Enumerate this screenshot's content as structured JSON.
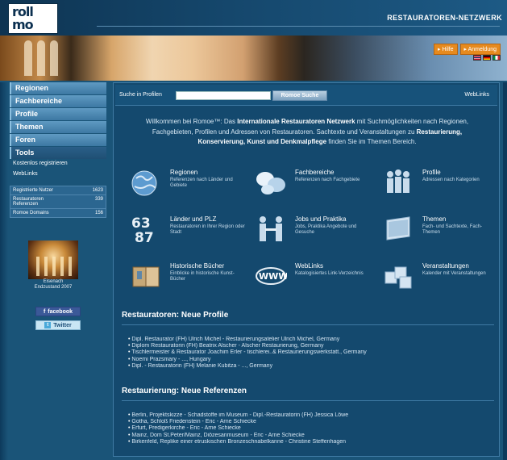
{
  "header": {
    "logo_line1": "roll",
    "logo_line2": "mo",
    "network_title": "RESTAURATOREN-NETZWERK",
    "help_label": "Hilfe",
    "login_label": "Anmeldung",
    "flags": [
      "english-flag",
      "german-flag",
      "italian-flag"
    ]
  },
  "nav": {
    "items": [
      {
        "label": "Regionen"
      },
      {
        "label": "Fachbereiche"
      },
      {
        "label": "Profile"
      },
      {
        "label": "Themen"
      },
      {
        "label": "Foren"
      },
      {
        "label": "Tools"
      }
    ],
    "sublinks": [
      "Kostenlos registrieren",
      "WebLinks"
    ],
    "stats": [
      {
        "label": "Registrierte Nutzer",
        "value": "1623"
      },
      {
        "label": "Restauratoren Referenzen",
        "value": "339"
      },
      {
        "label": "Romoe Domains",
        "value": "156"
      }
    ],
    "image_caption_line1": "Eisenach",
    "image_caption_line2": "Endzustand 2007",
    "facebook_label": "facebook",
    "twitter_label": "Twitter"
  },
  "search": {
    "label": "Suche in Profilen",
    "value": "",
    "button": "Romoe Suche",
    "weblinks": "WebLinks"
  },
  "intro": {
    "p1": "Willkommen bei Romoe™: Das ",
    "b1": "Internationale Restauratoren Netzwerk",
    "p2": " mit Suchmöglichkeiten nach Regionen, Fachgebieten, Profilen und Adressen von Restauratoren. Sachtexte und Veranstaltungen zu ",
    "b2": "Restaurierung, Konservierung, Kunst und Denkmalpflege",
    "p3": " finden Sie im Themen Bereich."
  },
  "tiles": [
    {
      "title": "Regionen",
      "sub": "Referenzen nach Länder und Gebiete",
      "icon": "globe-icon"
    },
    {
      "title": "Fachbereiche",
      "sub": "Referenzen nach Fachgebiete",
      "icon": "bubbles-icon"
    },
    {
      "title": "Profile",
      "sub": "Adressen nach Kategorien",
      "icon": "people-icon"
    },
    {
      "title": "Länder und PLZ",
      "sub": "Restauratoren in Ihrer Region oder Stadt",
      "icon": "numbers-icon"
    },
    {
      "title": "Jobs und Praktika",
      "sub": "Jobs, Praktika Angebote und Gesuche",
      "icon": "handshake-icon"
    },
    {
      "title": "Themen",
      "sub": "Fach- und Sachtexte, Fach-Themen",
      "icon": "board-icon"
    },
    {
      "title": "Historische Bücher",
      "sub": "Einblicke in historische Kunst-Bücher",
      "icon": "books-icon"
    },
    {
      "title": "WebLinks",
      "sub": "Katalogisiertes Link-Verzeichnis",
      "icon": "www-icon"
    },
    {
      "title": "Veranstaltungen",
      "sub": "Kalender mit Veranstaltungen",
      "icon": "calendar-icon"
    }
  ],
  "profiles": {
    "heading": "Restauratoren: Neue Profile",
    "items": [
      "Dipl. Restaurator (FH) Ulrich Michel - Restaurierungsatelier Ulrich Michel, Germany",
      "Diplom Restauratorin (FH) Beatrix Alscher - Alscher Restaurierung, Germany",
      "Tischlermeister & Restaurator Joachim Erler - tischlerei..& Restaurierungswerkstatt., Germany",
      "Noemi Prazsmary - ..., Hungary",
      "Dipl. - Restauratorin (FH) Melanie Kubitza - ..., Germany"
    ]
  },
  "references": {
    "heading": "Restaurierung: Neue Referenzen",
    "items": [
      "Berlin, Projektskizze - Schadstoffe im Museum - Dipl.-Restauratorin (FH) Jessica Löwe",
      "Gotha, Schloß Friedenstein - Eric - Arne Schiecke",
      "Erfurt, Predigerkirche - Eric - Arne Schiecke",
      "Mainz, Dom St.Peter/Mainz, Diözesanmuseum - Eric - Arne Schiecke",
      "Birkenfeld, Replike einer etruskischen Bronzeschnabelkanne - Christine Steffenhagen"
    ]
  }
}
